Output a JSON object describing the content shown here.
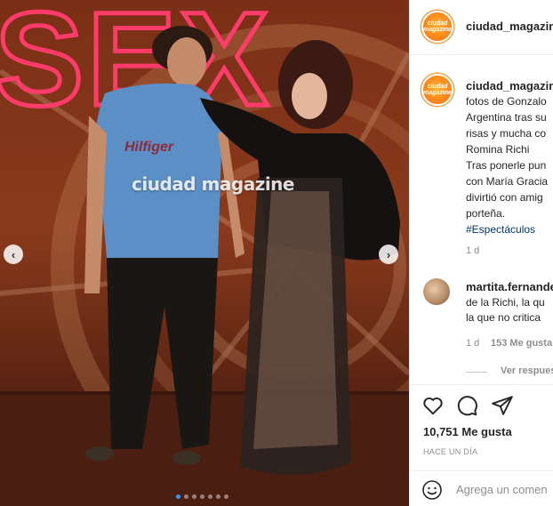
{
  "account": {
    "username": "ciudad_magazine",
    "avatar_text": "ciudad magazine"
  },
  "photo": {
    "neon_sign": "SEX",
    "watermark": "ciudad magazine",
    "prev_icon": "chevron-left-icon",
    "next_icon": "chevron-right-icon",
    "prev_glyph": "‹",
    "next_glyph": "›",
    "slide_count": 7,
    "active_slide": 1
  },
  "caption": {
    "lines": [
      "fotos de Gonzalo",
      "Argentina tras su",
      "risas y mucha co",
      "Romina Richi",
      "Tras ponerle pun",
      "con María Gracia",
      "divirtió con amig",
      "porteña."
    ],
    "hashtag": "#Espectáculos",
    "time": "1 d"
  },
  "comment": {
    "username": "martita.fernande",
    "lines": [
      "de la Richi, la qu",
      "la que no critica"
    ],
    "time": "1 d",
    "likes": "153 Me gusta",
    "view_replies": "Ver respues"
  },
  "actions": {
    "like_icon": "heart-icon",
    "comment_icon": "speech-bubble-icon",
    "share_icon": "paper-plane-icon",
    "likes_count": "10,751 Me gusta",
    "post_date": "HACE UN DÍA"
  },
  "add_comment": {
    "emoji_icon": "smiley-icon",
    "placeholder": "Agrega un comen"
  },
  "colors": {
    "link": "#00376b",
    "active_dot": "#3897f0",
    "neon": "#ff3b6b",
    "text": "#262626",
    "muted": "#8e8e8e"
  }
}
